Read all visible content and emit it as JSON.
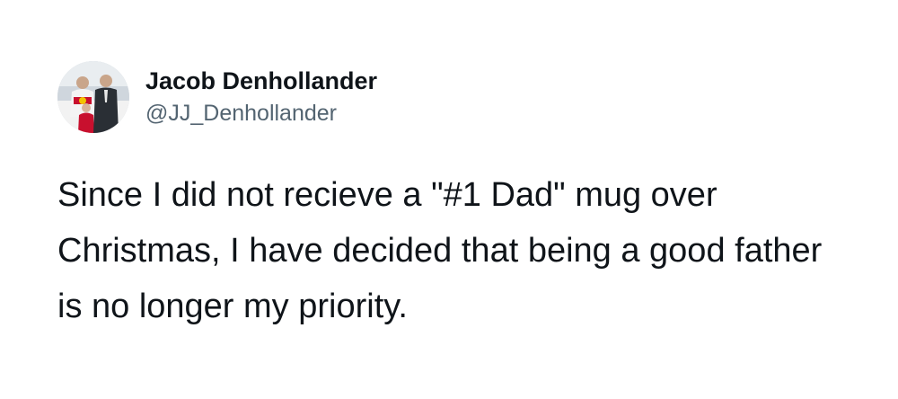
{
  "tweet": {
    "author": {
      "display_name": "Jacob Denhollander",
      "handle": "@JJ_Denhollander",
      "avatar_icon": "profile-photo-avatar"
    },
    "text": "Since I did not recieve a \"#1 Dad\" mug over Christmas, I have decided that being a good father is no longer my priority."
  },
  "colors": {
    "text_primary": "#0f1419",
    "text_secondary": "#536471",
    "background": "#ffffff"
  }
}
